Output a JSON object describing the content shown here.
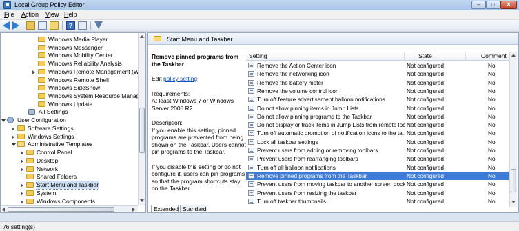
{
  "window": {
    "title": "Local Group Policy Editor",
    "min": "–",
    "max": "□",
    "close": "✕"
  },
  "menu": [
    {
      "label": "File",
      "key": "F",
      "rest": "ile"
    },
    {
      "label": "Action",
      "key": "A",
      "rest": "ction"
    },
    {
      "label": "View",
      "key": "V",
      "rest": "iew"
    },
    {
      "label": "Help",
      "key": "H",
      "rest": "elp"
    }
  ],
  "toolbar": {
    "icons": [
      "back-icon",
      "forward-icon",
      "up-folder-icon",
      "show-hide-tree-icon",
      "export-list-icon",
      "help-icon",
      "properties-icon",
      "filter-icon"
    ],
    "help_glyph": "?"
  },
  "tree": {
    "items": [
      {
        "label": "Windows Media Player",
        "icon": "folder-icon",
        "toggle": "none"
      },
      {
        "label": "Windows Messenger",
        "icon": "folder-icon",
        "toggle": "none"
      },
      {
        "label": "Windows Mobility Center",
        "icon": "folder-icon",
        "toggle": "none"
      },
      {
        "label": "Windows Reliability Analysis",
        "icon": "folder-icon",
        "toggle": "none"
      },
      {
        "label": "Windows Remote Management (WinF",
        "icon": "folder-icon",
        "toggle": "closed"
      },
      {
        "label": "Windows Remote Shell",
        "icon": "folder-icon",
        "toggle": "none"
      },
      {
        "label": "Windows SideShow",
        "icon": "folder-icon",
        "toggle": "none"
      },
      {
        "label": "Windows System Resource Manager",
        "icon": "folder-icon",
        "toggle": "none"
      },
      {
        "label": "Windows Update",
        "icon": "folder-icon",
        "toggle": "none"
      },
      {
        "label": "All Settings",
        "icon": "settings-icon",
        "toggle": "none"
      },
      {
        "label": "User Configuration",
        "icon": "user-icon",
        "toggle": "opened"
      },
      {
        "label": "Software Settings",
        "icon": "folder-icon",
        "toggle": "closed"
      },
      {
        "label": "Windows Settings",
        "icon": "folder-icon",
        "toggle": "closed"
      },
      {
        "label": "Administrative Templates",
        "icon": "folder-icon",
        "toggle": "opened"
      },
      {
        "label": "Control Panel",
        "icon": "folder-icon",
        "toggle": "closed"
      },
      {
        "label": "Desktop",
        "icon": "folder-icon",
        "toggle": "closed"
      },
      {
        "label": "Network",
        "icon": "folder-icon",
        "toggle": "closed"
      },
      {
        "label": "Shared Folders",
        "icon": "folder-icon",
        "toggle": "none"
      },
      {
        "label": "Start Menu and Taskbar",
        "icon": "folder-icon",
        "toggle": "closed",
        "selected": true
      },
      {
        "label": "System",
        "icon": "folder-icon",
        "toggle": "closed"
      },
      {
        "label": "Windows Components",
        "icon": "folder-icon",
        "toggle": "closed"
      },
      {
        "label": "All Settings",
        "icon": "settings-icon",
        "toggle": "none"
      }
    ]
  },
  "right": {
    "header": "Start Menu and Taskbar",
    "description": {
      "title": "Remove pinned programs from the Taskbar",
      "edit_prefix": "Edit ",
      "edit_link": "policy setting",
      "requirements_label": "Requirements:",
      "requirements": "At least Windows 7 or Windows Server 2008 R2",
      "description_label": "Description:",
      "description": "If you enable this setting, pinned programs are prevented from being shown on the Taskbar. Users cannot pin programs to the Taskbar.",
      "disable_note": "If you disable this setting or do not configure it, users can pin programs so that the program shortcuts stay on the Taskbar."
    },
    "columns": {
      "setting": "Setting",
      "state": "State",
      "comment": "Comment"
    },
    "rows": [
      {
        "setting": "Remove the Action Center icon",
        "state": "Not configured",
        "comment": "No"
      },
      {
        "setting": "Remove the networking icon",
        "state": "Not configured",
        "comment": "No"
      },
      {
        "setting": "Remove the battery meter",
        "state": "Not configured",
        "comment": "No"
      },
      {
        "setting": "Remove the volume control icon",
        "state": "Not configured",
        "comment": "No"
      },
      {
        "setting": "Turn off feature advertisement balloon notifications",
        "state": "Not configured",
        "comment": "No"
      },
      {
        "setting": "Do not allow pinning items in Jump Lists",
        "state": "Not configured",
        "comment": "No"
      },
      {
        "setting": "Do not allow pinning programs to the Taskbar",
        "state": "Not configured",
        "comment": "No"
      },
      {
        "setting": "Do not display or track items in Jump Lists from remote loca...",
        "state": "Not configured",
        "comment": "No"
      },
      {
        "setting": "Turn off automatic promotion of notification icons to the ta...",
        "state": "Not configured",
        "comment": "No"
      },
      {
        "setting": "Lock all taskbar settings",
        "state": "Not configured",
        "comment": "No"
      },
      {
        "setting": "Prevent users from adding or removing toolbars",
        "state": "Not configured",
        "comment": "No"
      },
      {
        "setting": "Prevent users from rearranging toolbars",
        "state": "Not configured",
        "comment": "No"
      },
      {
        "setting": "Turn off all balloon notifications",
        "state": "Not configured",
        "comment": "No"
      },
      {
        "setting": "Remove pinned programs from the Taskbar",
        "state": "Not configured",
        "comment": "No",
        "selected": true
      },
      {
        "setting": "Prevent users from moving taskbar to another screen dock l...",
        "state": "Not configured",
        "comment": "No"
      },
      {
        "setting": "Prevent users from resizing the taskbar",
        "state": "Not configured",
        "comment": "No"
      },
      {
        "setting": "Turn off taskbar thumbnails",
        "state": "Not configured",
        "comment": "No"
      }
    ],
    "tabs": [
      {
        "label": "Extended",
        "active": true
      },
      {
        "label": "Standard",
        "active": false
      }
    ]
  },
  "status": "76 setting(s)",
  "colors": {
    "selection": "#3d7bd8",
    "link": "#0b50c8",
    "folder": "#f3cd5b"
  }
}
